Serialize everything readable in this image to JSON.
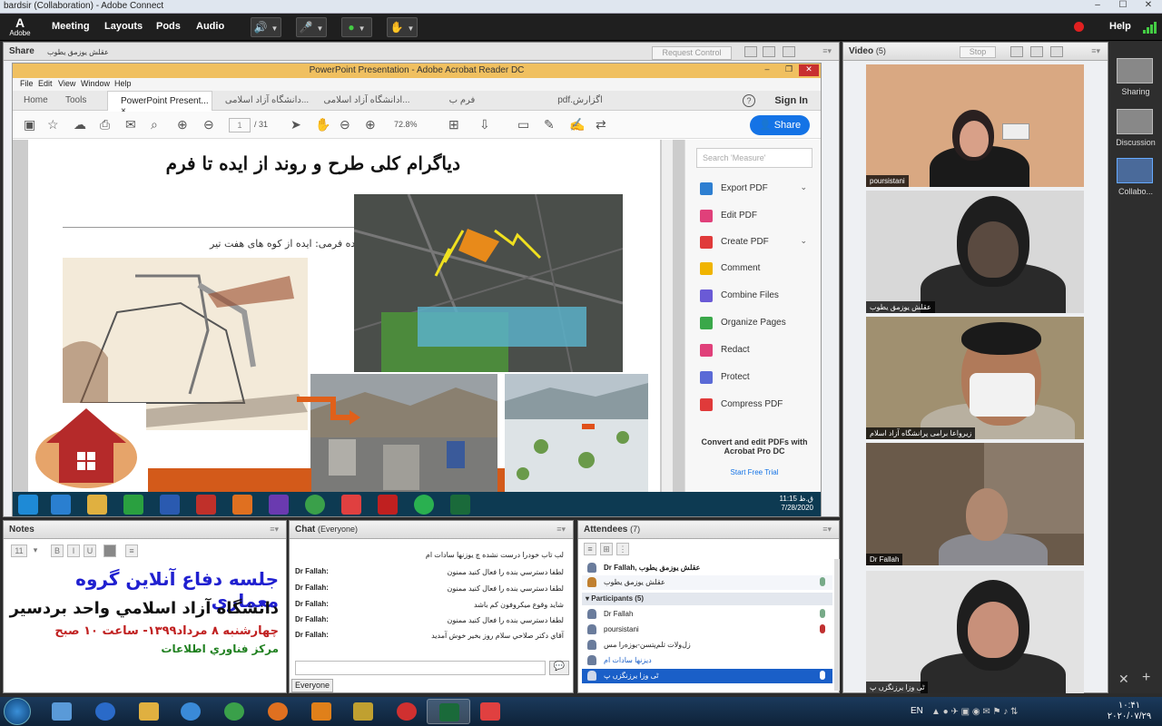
{
  "window": {
    "title": "bardsir (Collaboration) - Adobe Connect"
  },
  "menubar": {
    "logo": "Adobe",
    "items": [
      "Meeting",
      "Layouts",
      "Pods",
      "Audio"
    ],
    "help": "Help"
  },
  "share_pod": {
    "title": "Share",
    "presenter": "عقلش یوزمق یطوب",
    "request_control": "Request Control"
  },
  "acrobat": {
    "title": "PowerPoint Presentation - Adobe Acrobat Reader DC",
    "menu": [
      "File",
      "Edit",
      "View",
      "Window",
      "Help"
    ],
    "tabs": [
      "Home",
      "Tools",
      "PowerPoint Present...",
      "دانشگاه آزاد اسلامی...",
      "ادانشگاه آزاد اسلامی...",
      "فرم ب",
      "pdf.اگزارش"
    ],
    "sign_in": "Sign In",
    "page_current": "1",
    "page_total": "/ 31",
    "zoom": "72.8%",
    "share_button": "Share",
    "slide": {
      "title": "دیاگرام کلی طرح و روند از ایده تا فرم",
      "idea_caption": "ایده فرمی: ایده از کوه های هفت تیر"
    },
    "right_pane": {
      "search_placeholder": "Search 'Measure'",
      "tools": [
        {
          "label": "Export PDF",
          "color": "#2e7fd1",
          "chevron": true
        },
        {
          "label": "Edit PDF",
          "color": "#e0407a",
          "chevron": false
        },
        {
          "label": "Create PDF",
          "color": "#e03a3a",
          "chevron": true
        },
        {
          "label": "Comment",
          "color": "#f0b400",
          "chevron": false
        },
        {
          "label": "Combine Files",
          "color": "#6a5ad6",
          "chevron": false
        },
        {
          "label": "Organize Pages",
          "color": "#3aa84a",
          "chevron": false
        },
        {
          "label": "Redact",
          "color": "#e0407a",
          "chevron": false
        },
        {
          "label": "Protect",
          "color": "#5a6ad6",
          "chevron": false
        },
        {
          "label": "Compress PDF",
          "color": "#e03a3a",
          "chevron": false
        }
      ],
      "promo": "Convert and edit PDFs with Acrobat Pro DC",
      "trial": "Start Free Trial"
    },
    "inner_clock": {
      "time": "11:15 ق.ظ",
      "date": "7/28/2020"
    }
  },
  "video_pod": {
    "title": "Video",
    "count": "(5)",
    "stop": "Stop",
    "participants": [
      {
        "name": "poursistani"
      },
      {
        "name": "عقلش یوزمق یطوب"
      },
      {
        "name": "زیرواعا برامی پرانشگاه آزاد اسلام"
      },
      {
        "name": "Dr Fallah"
      },
      {
        "name": "ٹی وزا یرزنگزں پ"
      }
    ]
  },
  "layouts_panel": {
    "items": [
      "Sharing",
      "Discussion",
      "Collabo..."
    ]
  },
  "notes_pod": {
    "title": "Notes",
    "font_size": "11",
    "lines": [
      "جلسه دفاع آنلاین گروه معماري",
      "دانشگاه آزاد اسلامي واحد بردسير",
      "چهارشنبه ۸ مرداد۱۳۹۹- ساعت ۱۰ صبح",
      "مركز فناوري اطلاعات"
    ]
  },
  "chat_pod": {
    "title": "Chat",
    "audience": "(Everyone)",
    "messages": [
      {
        "from": "",
        "text": "لب تاب خودرا درست نشده چ یوزنها سادات ام"
      },
      {
        "from": "Dr Fallah:",
        "text": "لطفا دسترسي بنده را فعال كنيد ممنون"
      },
      {
        "from": "Dr Fallah:",
        "text": "لطفا دسترسي بنده را فعال كنيد ممنون"
      },
      {
        "from": "Dr Fallah:",
        "text": "شايد وقوع ميكروفون كم باشد"
      },
      {
        "from": "Dr Fallah:",
        "text": "لطفا دسترسي بنده را فعال كنيد ممنون"
      },
      {
        "from": "Dr Fallah:",
        "text": "آقاي دكتر صلاحي سلام روز بخير خوش آمديد"
      }
    ],
    "send_to": "Everyone"
  },
  "attendees_pod": {
    "title": "Attendees",
    "count": "(7)",
    "host_header": "Dr Fallah, عقلش یوزمق یطوب",
    "host": "عقلش یوزمق یطوب",
    "participants_header": "Participants (5)",
    "participants": [
      {
        "name": "Dr Fallah",
        "selected": false
      },
      {
        "name": "poursistani",
        "selected": false
      },
      {
        "name": "زل‌ولات تلم‌پتسن-یو‌زه‌را مس",
        "selected": false
      },
      {
        "name": "دیزنها سادات ام",
        "selected": false
      },
      {
        "name": "ٹی وزا یرزنگزں پ",
        "selected": true
      }
    ]
  },
  "taskbar": {
    "lang": "EN",
    "time": "۱۰:۴۱",
    "date": "۲۰۲۰/۰۷/۲۹"
  }
}
